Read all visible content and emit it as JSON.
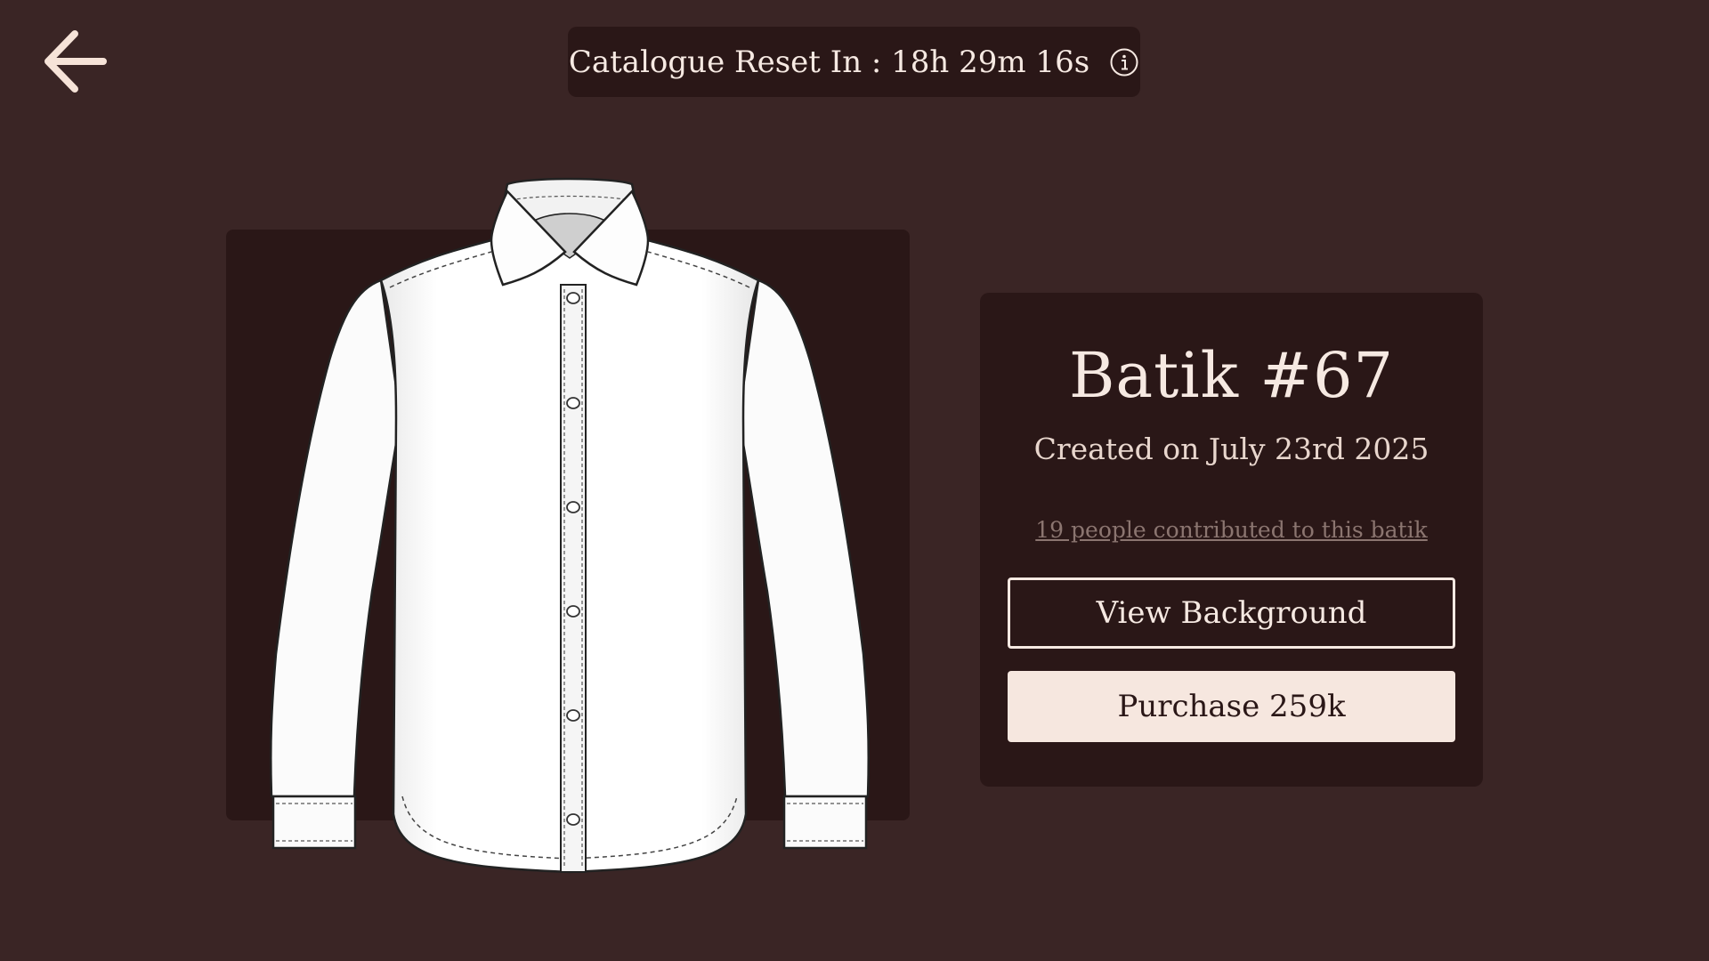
{
  "header": {
    "back_icon": "arrow-left-icon",
    "timer_text": "Catalogue Reset In : 18h 29m 16s",
    "info_icon": "info-icon"
  },
  "preview": {
    "image": "shirt-illustration"
  },
  "details": {
    "title": "Batik #67",
    "created": "Created on July 23rd 2025",
    "contributors_link": "19 people contributed to this batik",
    "view_background_label": "View Background",
    "purchase_label": "Purchase 259k"
  },
  "colors": {
    "background": "#3a2525",
    "panel": "#2a1717",
    "text": "#f6e9e2",
    "muted_link": "#8b7570",
    "button_fill": "#f6e7df"
  }
}
